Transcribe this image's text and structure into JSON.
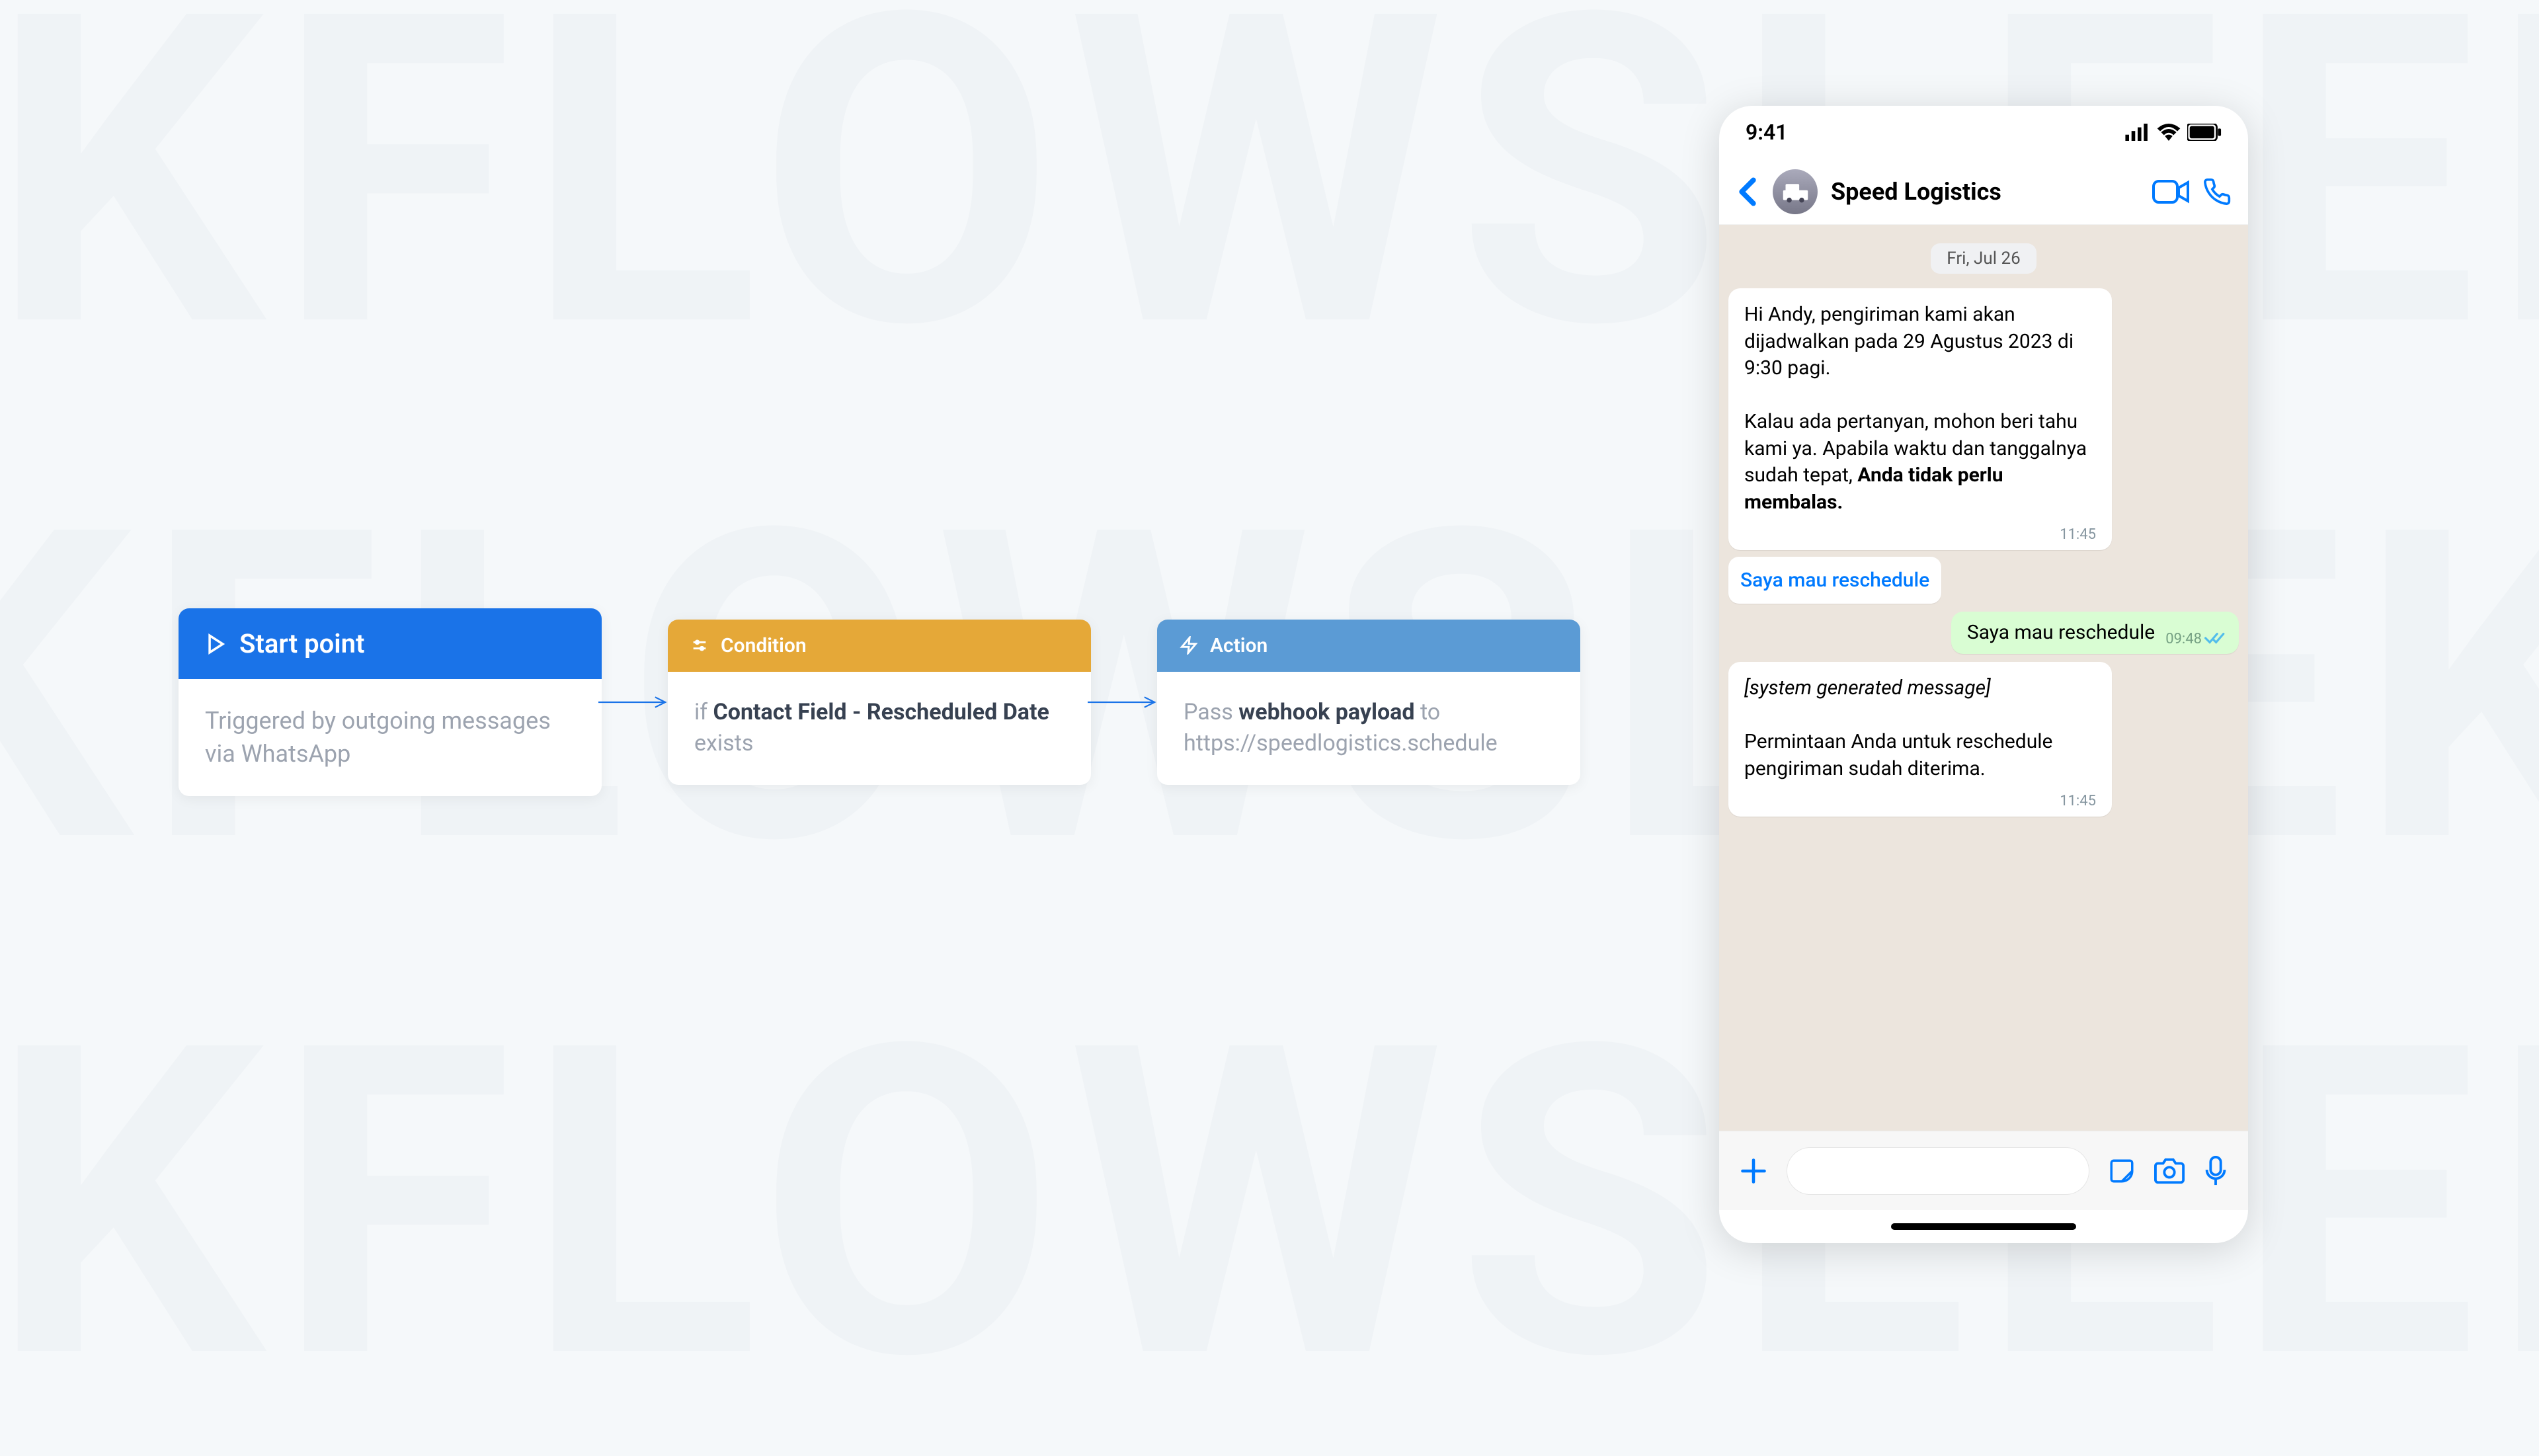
{
  "bg": "EKFLOWSLEEK",
  "flow": {
    "start": {
      "title": "Start point",
      "desc": "Triggered by outgoing messages via WhatsApp"
    },
    "condition": {
      "title": "Condition",
      "prefix": "if ",
      "bold": "Contact Field - Rescheduled Date",
      "suffix": " exists"
    },
    "action": {
      "title": "Action",
      "prefix": "Pass ",
      "bold": "webhook payload",
      "suffix": " to",
      "url": "https://speedlogistics.schedule"
    }
  },
  "phone": {
    "time": "9:41",
    "contact": "Speed Logistics",
    "date": "Fri, Jul 26",
    "msg1_p1": "Hi Andy, pengiriman kami akan dijadwalkan pada 29 Agustus 2023 di 9:30 pagi.",
    "msg1_p2a": "Kalau ada pertanyan, mohon beri tahu kami ya. Apabila waktu dan tanggalnya sudah tepat, ",
    "msg1_p2b": "Anda tidak perlu membalas.",
    "msg1_time": "11:45",
    "quick_reply": "Saya mau reschedule",
    "msg2": "Saya mau reschedule",
    "msg2_time": "09:48",
    "msg3_sys": "[system generated message]",
    "msg3": "Permintaan Anda untuk reschedule pengiriman sudah diterima.",
    "msg3_time": "11:45"
  }
}
